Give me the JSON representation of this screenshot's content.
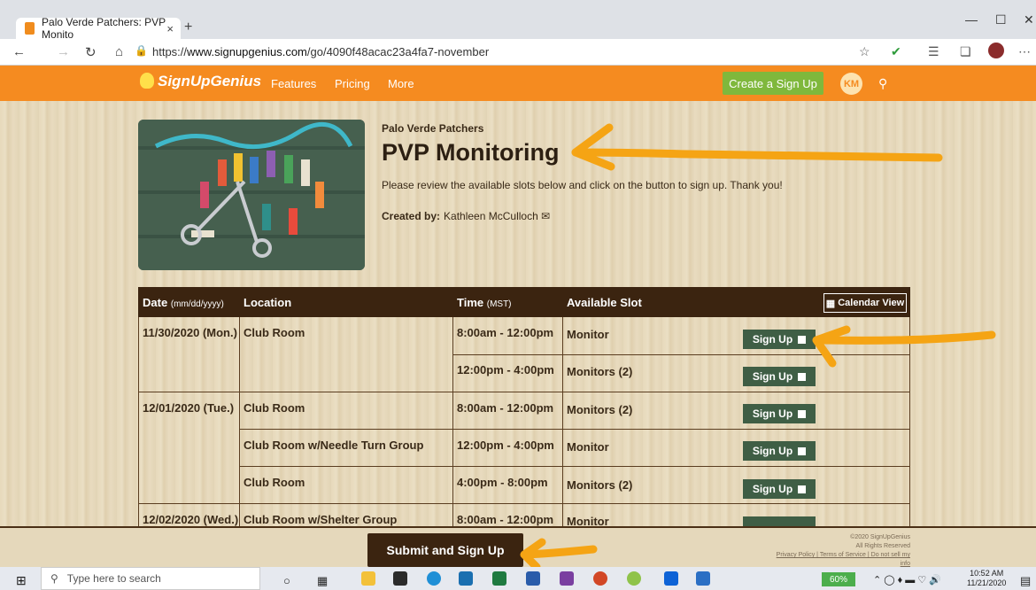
{
  "browser": {
    "tab_title": "Palo Verde Patchers: PVP Monito",
    "tab_close": "×",
    "new_tab": "+",
    "url_prefix": "https://",
    "url_host": "www.signupgenius.com",
    "url_path": "/go/4090f48acac23a4fa7-november",
    "icons": [
      "back-icon",
      "forward-icon",
      "refresh-icon",
      "home-icon",
      "lock-icon",
      "star-icon",
      "shield-icon",
      "favorites-icon",
      "collections-icon",
      "profile-icon",
      "more-icon"
    ]
  },
  "site_header": {
    "logo": "SignUpGenius",
    "nav": [
      "Features",
      "Pricing",
      "More"
    ],
    "create_button": "Create a Sign Up",
    "avatar_initials": "KM",
    "accent": "#f58b20",
    "create_color": "#7fb83c"
  },
  "signup": {
    "org": "Palo Verde Patchers",
    "title": "PVP Monitoring",
    "description": "Please review the available slots below and click on the button to sign up. Thank you!",
    "created_by_label": "Created by:",
    "creator": "Kathleen McCulloch"
  },
  "table": {
    "headers": {
      "date": "Date",
      "date_hint": "(mm/dd/yyyy)",
      "location": "Location",
      "time": "Time",
      "time_hint": "(MST)",
      "slot": "Available Slot"
    },
    "calendar_button": "Calendar View",
    "signup_label": "Sign Up",
    "rows": [
      {
        "date": "11/30/2020 (Mon.)",
        "location": "Club Room",
        "time": "8:00am - 12:00pm",
        "slot": "Monitor"
      },
      {
        "date": "",
        "location": "",
        "time": "12:00pm - 4:00pm",
        "slot": "Monitors (2)"
      },
      {
        "date": "12/01/2020 (Tue.)",
        "location": "Club Room",
        "time": "8:00am - 12:00pm",
        "slot": "Monitors (2)"
      },
      {
        "date": "",
        "location": "Club Room w/Needle Turn Group",
        "time": "12:00pm - 4:00pm",
        "slot": "Monitor"
      },
      {
        "date": "",
        "location": "Club Room",
        "time": "4:00pm - 8:00pm",
        "slot": "Monitors (2)"
      },
      {
        "date": "12/02/2020 (Wed.)",
        "location": "Club Room w/Shelter Group",
        "time": "8:00am - 12:00pm",
        "slot": "Monitor"
      }
    ]
  },
  "footer": {
    "submit_button": "Submit and Sign Up",
    "copyright": "©2020 SignUpGenius",
    "rights": "All Rights Reserved",
    "links": "Privacy Policy | Terms of Service | Do not sell my info"
  },
  "taskbar": {
    "search_placeholder": "Type here to search",
    "battery": "60%",
    "time": "10:52 AM",
    "date": "11/21/2020"
  }
}
